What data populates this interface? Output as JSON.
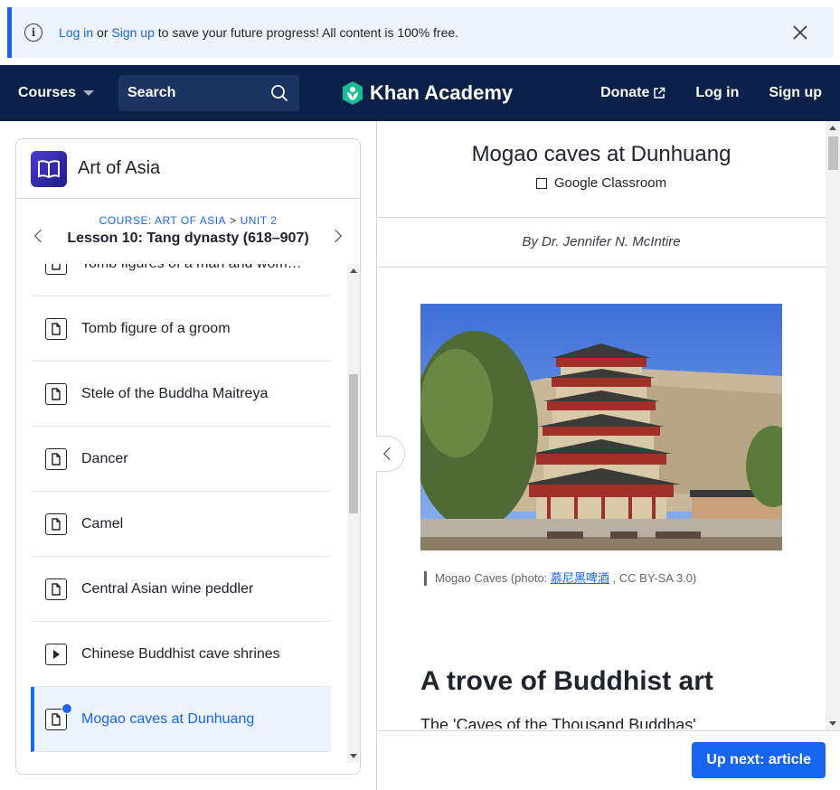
{
  "banner": {
    "login_link": "Log in",
    "or_text": " or ",
    "signup_link": "Sign up",
    "message": " to save your future progress! All content is 100% free."
  },
  "nav": {
    "courses": "Courses",
    "search_placeholder": "Search",
    "logo_text": "Khan Academy",
    "donate": "Donate",
    "login": "Log in",
    "signup": "Sign up"
  },
  "sidebar": {
    "title": "Art of Asia",
    "course_crumb": "COURSE: ART OF ASIA",
    "crumb_sep": ">",
    "unit_crumb": "UNIT 2",
    "lesson": "Lesson 10: Tang dynasty (618–907)",
    "items": [
      {
        "label": "Tomb figures of a man and woma…",
        "type": "article"
      },
      {
        "label": "Tomb figure of a groom",
        "type": "article"
      },
      {
        "label": "Stele of the Buddha Maitreya",
        "type": "article"
      },
      {
        "label": "Dancer",
        "type": "article"
      },
      {
        "label": "Camel",
        "type": "article"
      },
      {
        "label": "Central Asian wine peddler",
        "type": "article"
      },
      {
        "label": "Chinese Buddhist cave shrines",
        "type": "video"
      },
      {
        "label": "Mogao caves at Dunhuang",
        "type": "article",
        "active": true
      }
    ]
  },
  "article": {
    "title": "Mogao caves at Dunhuang",
    "classroom": "Google Classroom",
    "byline": "By Dr. Jennifer N. McIntire",
    "caption_prefix": "Mogao Caves (photo: ",
    "caption_link": "慕尼黑啤酒",
    "caption_suffix": " , CC BY-SA 3.0)",
    "heading": "A trove of Buddhist art",
    "paragraph_start": "The 'Caves of the Thousand Buddhas'"
  },
  "footer": {
    "up_next": "Up next: article"
  },
  "colors": {
    "brand_blue": "#1865f2",
    "nav_bg": "#0b2149",
    "banner_bg": "#edf3fc",
    "logo_green": "#14bf96"
  }
}
